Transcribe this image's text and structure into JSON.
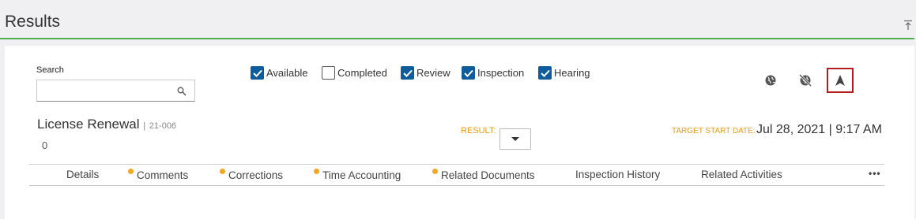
{
  "header": {
    "title": "Results"
  },
  "search": {
    "label": "Search",
    "value": "",
    "placeholder": ""
  },
  "filters": [
    {
      "label": "Available",
      "checked": true
    },
    {
      "label": "Completed",
      "checked": false
    },
    {
      "label": "Review",
      "checked": true
    },
    {
      "label": "Inspection",
      "checked": true
    },
    {
      "label": "Hearing",
      "checked": true
    }
  ],
  "record": {
    "title": "License Renewal",
    "separator": "|",
    "id": "21-006",
    "count": "0"
  },
  "result": {
    "label": "RESULT:",
    "value": ""
  },
  "target": {
    "label": "TARGET START DATE:",
    "value": "Jul 28, 2021 | 9:17 AM"
  },
  "tabs": [
    {
      "label": "Details",
      "dot": false
    },
    {
      "label": "Comments",
      "dot": true
    },
    {
      "label": "Corrections",
      "dot": true
    },
    {
      "label": "Time Accounting",
      "dot": true
    },
    {
      "label": "Related Documents",
      "dot": true
    },
    {
      "label": "Inspection History",
      "dot": false
    },
    {
      "label": "Related Activities",
      "dot": false
    }
  ],
  "more": "•••",
  "icons": {
    "collapse": "collapse-to-top-icon",
    "search": "search-icon",
    "globe": "globe-icon",
    "globe_off": "globe-off-icon",
    "navigate": "navigate-arrow-icon"
  },
  "colors": {
    "accent_green": "#4caf50",
    "checkbox_blue": "#0f5c9c",
    "label_orange": "#e89a1c",
    "dot_orange": "#f5a623",
    "nav_border": "#b31c1c"
  }
}
